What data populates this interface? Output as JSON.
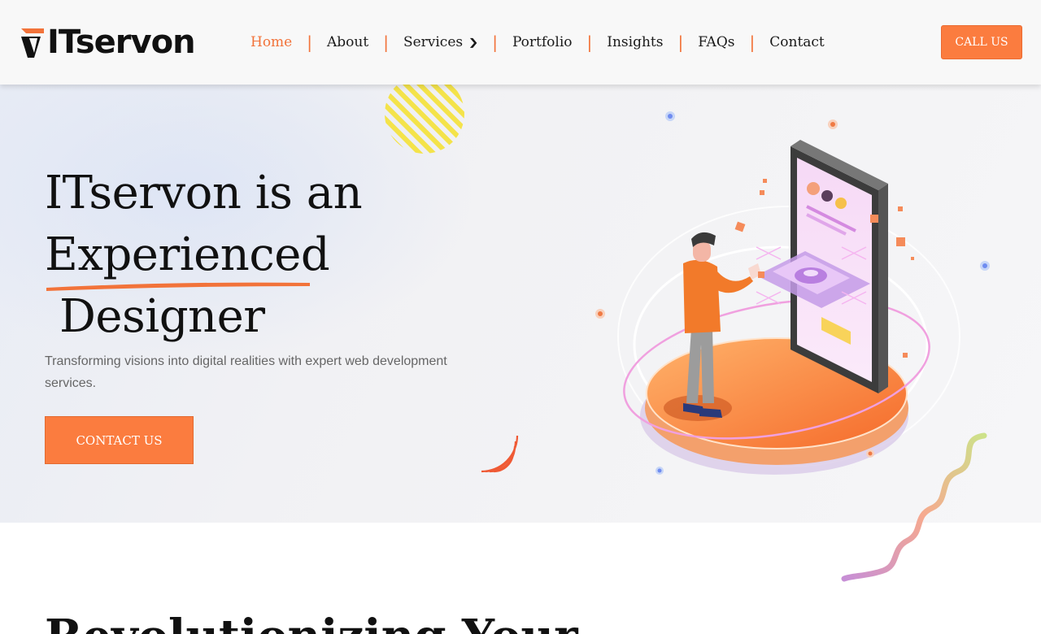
{
  "brand": {
    "name": "ITservon",
    "accent_color": "#fb7c3f"
  },
  "nav": {
    "items": [
      {
        "label": "Home",
        "active": true
      },
      {
        "label": "About"
      },
      {
        "label": "Services",
        "has_dropdown": true
      },
      {
        "label": "Portfolio"
      },
      {
        "label": "Insights"
      },
      {
        "label": "FAQs"
      },
      {
        "label": "Contact"
      }
    ],
    "separator": "|",
    "dropdown_icon": "chevron-down-icon"
  },
  "header": {
    "call_label": "CALL US"
  },
  "hero": {
    "headline_line1": "ITservon is an",
    "headline_highlight": "Experienced",
    "headline_line3": "Designer",
    "subtitle": "Transforming visions into digital realities with expert web development services.",
    "cta_label": "CONTACT US",
    "illustration": "person-with-phone-isometric-illustration"
  },
  "section2": {
    "title": "Revolutionizing Your"
  }
}
